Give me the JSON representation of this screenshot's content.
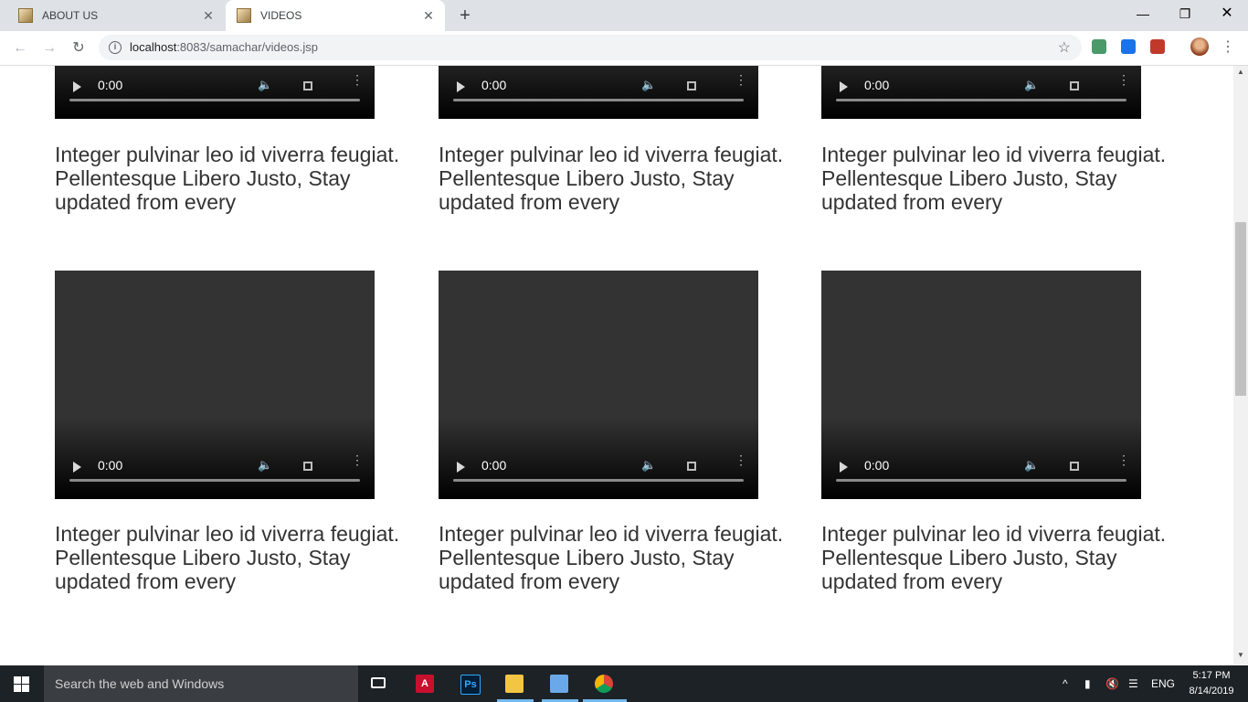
{
  "browser": {
    "tabs": [
      {
        "title": "ABOUT US",
        "active": false
      },
      {
        "title": "VIDEOS",
        "active": true
      }
    ],
    "url_host": "localhost",
    "url_path": ":8083/samachar/videos.jsp"
  },
  "videos": [
    {
      "time": "0:00",
      "caption": "Integer pulvinar leo id viverra feugiat. Pellentesque Libero Justo, Stay updated from every"
    },
    {
      "time": "0:00",
      "caption": "Integer pulvinar leo id viverra feugiat. Pellentesque Libero Justo, Stay updated from every"
    },
    {
      "time": "0:00",
      "caption": "Integer pulvinar leo id viverra feugiat. Pellentesque Libero Justo, Stay updated from every"
    },
    {
      "time": "0:00",
      "caption": "Integer pulvinar leo id viverra feugiat. Pellentesque Libero Justo, Stay updated from every"
    },
    {
      "time": "0:00",
      "caption": "Integer pulvinar leo id viverra feugiat. Pellentesque Libero Justo, Stay updated from every"
    },
    {
      "time": "0:00",
      "caption": "Integer pulvinar leo id viverra feugiat. Pellentesque Libero Justo, Stay updated from every"
    }
  ],
  "taskbar": {
    "search_placeholder": "Search the web and Windows",
    "language": "ENG",
    "time": "5:17 PM",
    "date": "8/14/2019"
  },
  "colors": {
    "tabstrip": "#dee1e6",
    "video_bg": "#333333",
    "caption_text": "#333333",
    "taskbar": "#1c2226"
  }
}
